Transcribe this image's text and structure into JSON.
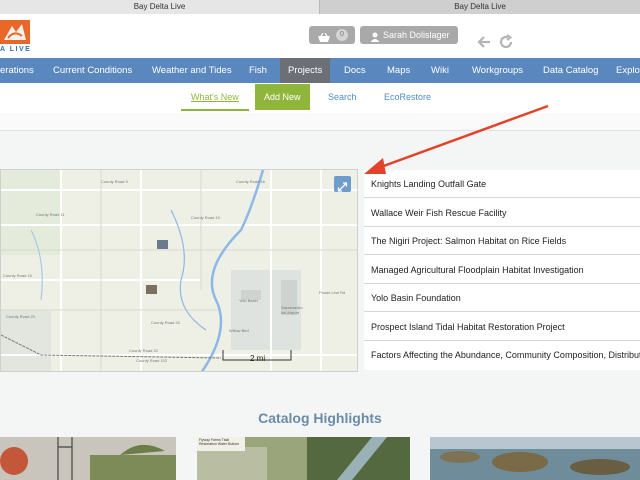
{
  "browser": {
    "tabs": [
      "Bay Delta Live",
      "Bay Delta Live"
    ]
  },
  "header": {
    "logo_text": "A LIVE",
    "cart_count": "0",
    "user_name": "Sarah Dolislager"
  },
  "main_nav": {
    "items": [
      "erations",
      "Current Conditions",
      "Weather and Tides",
      "Fish",
      "Projects",
      "Docs",
      "Maps",
      "Wiki",
      "Workgroups",
      "Data Catalog",
      "Explor"
    ],
    "active": "Projects"
  },
  "sub_nav": {
    "items": [
      "What's New",
      "Add New",
      "Search",
      "EcoRestore"
    ]
  },
  "map": {
    "scale_label": "2 mi",
    "labels": [
      "County Road 9",
      "County Road 16",
      "County Road 11",
      "County Road 19",
      "County Road 15",
      "County Road 23",
      "County Road 22",
      "County Road 20",
      "Yolo Basin",
      "Willow Bird",
      "County Road 102",
      "Sacramento Intl Airport",
      "Power Line Rd"
    ]
  },
  "projects": [
    "Knights Landing Outfall Gate",
    "Wallace Weir Fish Rescue Facility",
    "The Nigiri Project: Salmon Habitat on Rice Fields",
    "Managed Agricultural Floodplain Habitat Investigation",
    "Yolo Basin Foundation",
    "Prospect Island Tidal Habitat Restoration Project",
    "Factors Affecting the Abundance, Community Composition, Distribut"
  ],
  "catalog": {
    "title": "Catalog Highlights",
    "thumb_caption": "Flyway Farms Tidal Restoration Water Bottom"
  },
  "colors": {
    "nav_blue": "#5b87bf",
    "active_tab": "#6c6f76",
    "green": "#8fb63a",
    "link_blue": "#4f8ec4",
    "annotation_red": "#e2432a"
  }
}
